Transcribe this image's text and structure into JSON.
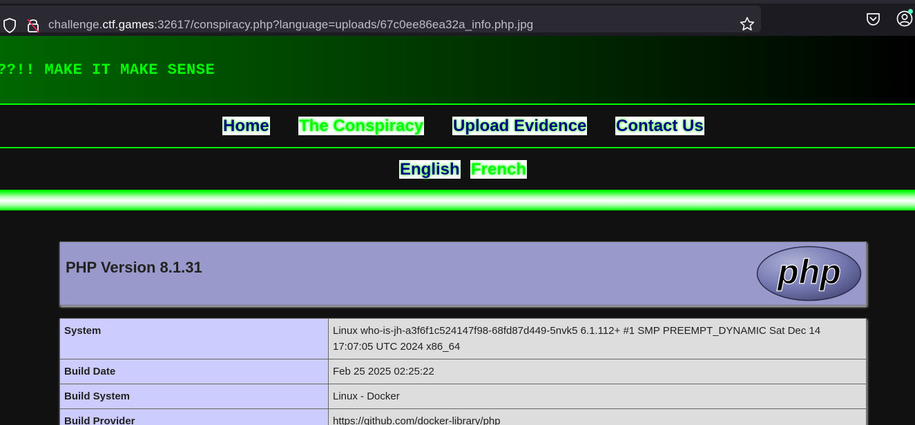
{
  "browser": {
    "url_prefix": "challenge.",
    "url_domain": "ctf.games",
    "url_suffix": ":32617/conspiracy.php?language=uploads/67c0ee86ea32a_info.php.jpg"
  },
  "site": {
    "title": "??!! MAKE IT MAKE SENSE"
  },
  "nav": {
    "home": "Home",
    "conspiracy": "The Conspiracy",
    "upload": "Upload Evidence",
    "contact": "Contact Us"
  },
  "lang": {
    "english": "English",
    "french": "French"
  },
  "phpinfo": {
    "version": "PHP Version 8.1.31",
    "logo_text": "php",
    "rows": [
      {
        "key": "System",
        "value": "Linux who-is-jh-a3f6f1c524147f98-68fd87d449-5nvk5 6.1.112+ #1 SMP PREEMPT_DYNAMIC Sat Dec 14 17:07:05 UTC 2024 x86_64"
      },
      {
        "key": "Build Date",
        "value": "Feb 25 2025 02:25:22"
      },
      {
        "key": "Build System",
        "value": "Linux - Docker"
      },
      {
        "key": "Build Provider",
        "value": "https://github.com/docker-library/php"
      }
    ]
  },
  "colors": {
    "accent_green": "#00ff00",
    "php_purple": "#9999cc"
  }
}
